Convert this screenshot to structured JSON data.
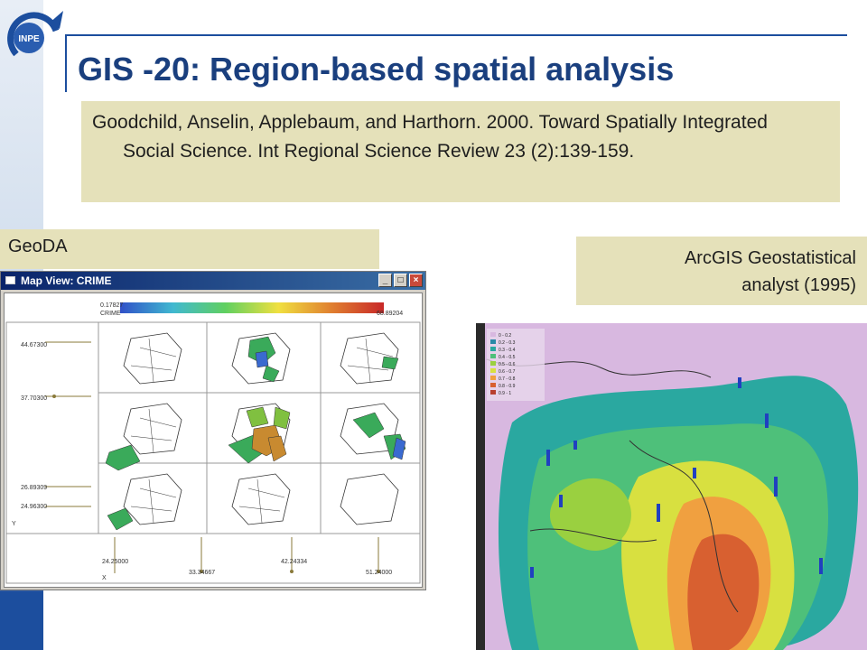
{
  "header": {
    "logo_text": "INPE",
    "title": "GIS -20: Region-based spatial analysis"
  },
  "citation": {
    "text": "Goodchild, Anselin, Applebaum, and Harthorn. 2000. Toward Spatially Integrated Social Science. Int Regional Science Review 23 (2):139-159."
  },
  "geoda": {
    "label": "GeoDA",
    "window_title": "Map View: CRIME",
    "legend_min": "0.17827",
    "legend_max": "68.89204",
    "variable": "CRIME",
    "y_values": [
      "44.67300",
      "37.70300",
      "26.89309",
      "24.96300"
    ],
    "x_values": [
      "24.25000",
      "33.34667",
      "42.24334",
      "51.24000"
    ],
    "y_axis_label": "Y",
    "x_axis_label": "X"
  },
  "arcgis": {
    "label_line1": "ArcGIS Geostatistical",
    "label_line2": "analyst (1995)",
    "legend": [
      "0 - 0.2",
      "0.2 - 0.3",
      "0.3 - 0.4",
      "0.4 - 0.5",
      "0.5 - 0.6",
      "0.6 - 0.7",
      "0.7 - 0.8",
      "0.8 - 0.9",
      "0.9 - 1"
    ]
  }
}
